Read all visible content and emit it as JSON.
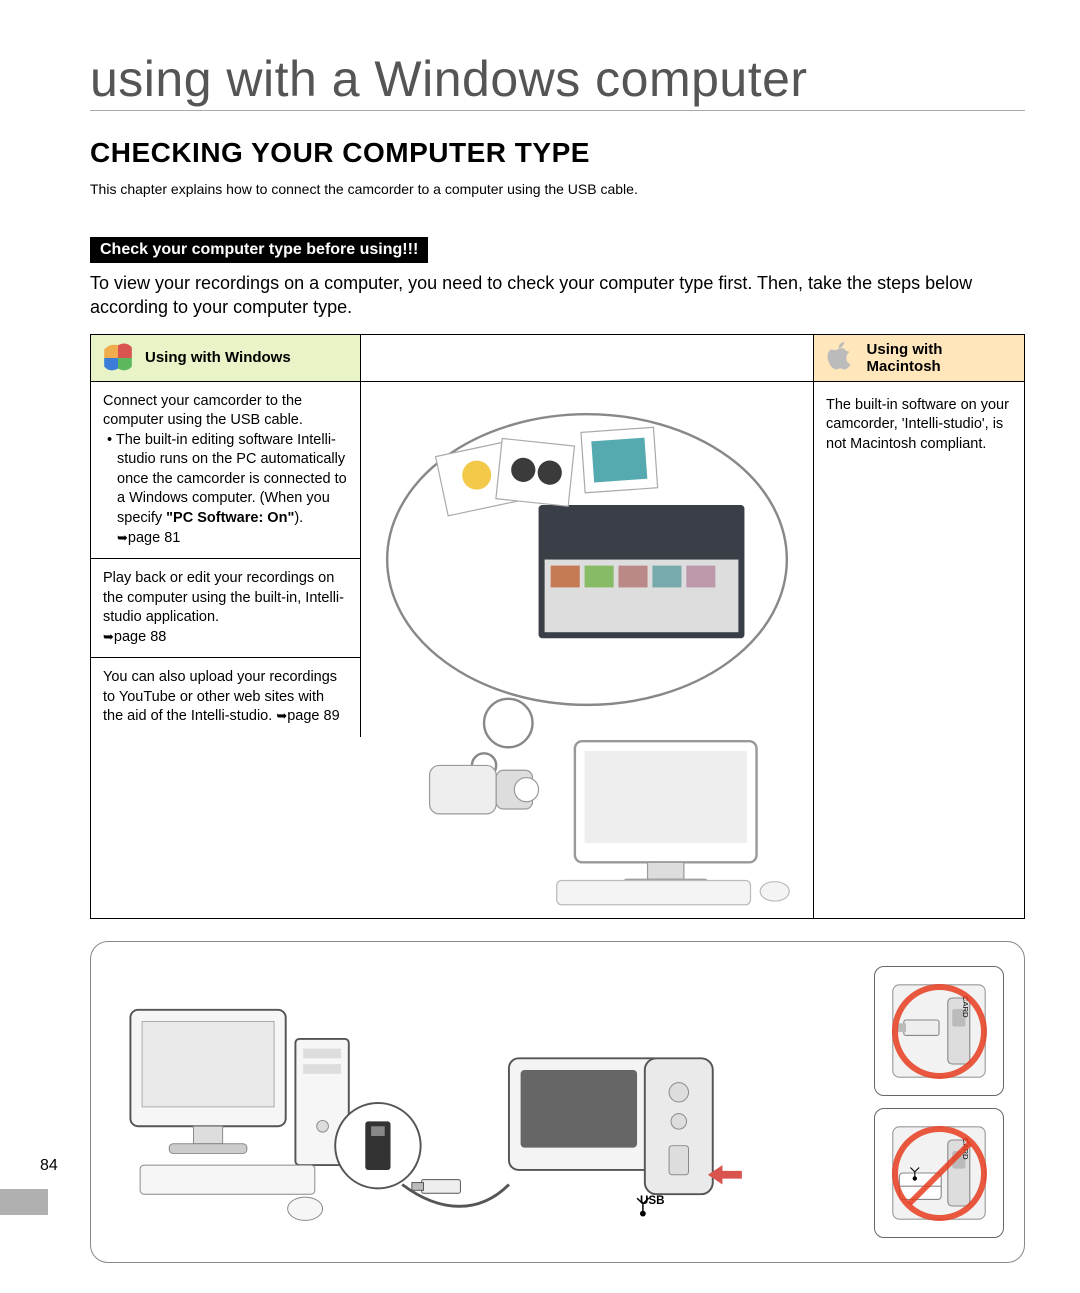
{
  "chapter_title": "using with a Windows computer",
  "section_heading": "CHECKING YOUR COMPUTER TYPE",
  "intro_small": "This chapter explains how to connect the camcorder to a computer using the USB cable.",
  "banner": "Check your computer type before using!!!",
  "lead": "To view your recordings on a computer, you need to check your computer type first. Then, take the steps below according to your computer type.",
  "columns": {
    "windows_header": "Using with Windows",
    "mac_header": "Using with Macintosh"
  },
  "windows": {
    "block1_line1": "Connect your camcorder to the computer using the USB cable.",
    "block1_bullet_pre": "The built-in editing software Intelli-studio runs on the PC automatically once the camcorder is connected to a Windows computer. (When you specify ",
    "block1_bullet_bold": "\"PC Software: On\"",
    "block1_bullet_post": "). ",
    "block1_pageref": "page 81",
    "block2_text": "Play back or edit your recordings on the computer using the built-in, Intelli-studio application.",
    "block2_pageref": "page 88",
    "block3_text": "You can also upload your recordings to YouTube or other web sites with the aid of the Intelli-studio. ",
    "block3_pageref": "page 89"
  },
  "mac": {
    "text": "The built-in software on your camcorder, 'Intelli-studio', is not Macintosh compliant."
  },
  "bottom": {
    "usb_label": "USB"
  },
  "page_number": "84"
}
